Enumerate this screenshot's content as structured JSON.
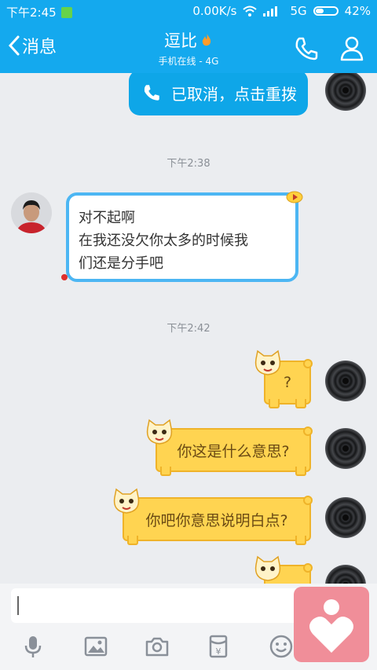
{
  "status_bar": {
    "time": "下午2:45",
    "speed": "0.00K/s",
    "network": "5G",
    "battery": "42%",
    "battery_level": 0.42
  },
  "header": {
    "back_label": "消息",
    "title": "逗比",
    "subtitle": "手机在线 - 4G"
  },
  "messages": {
    "call_text": "已取消，点击重拨",
    "timestamp1": "下午2:38",
    "friend_lines": [
      "对不起啊",
      "在我还没欠你太多的时候我",
      "们还是分手吧"
    ],
    "timestamp2": "下午2:42",
    "q_text": "?",
    "me_text1": "你这是什么意思?",
    "me_text2": "你吧你意思说明白点?"
  },
  "colors": {
    "accent": "#14a9ee",
    "yellow_bubble": "#ffd451",
    "friend_border": "#4cb6f3",
    "heart": "#f08e99"
  },
  "toolbar_icons": [
    "mic-icon",
    "image-icon",
    "camera-icon",
    "red-packet-icon",
    "emoji-icon"
  ]
}
